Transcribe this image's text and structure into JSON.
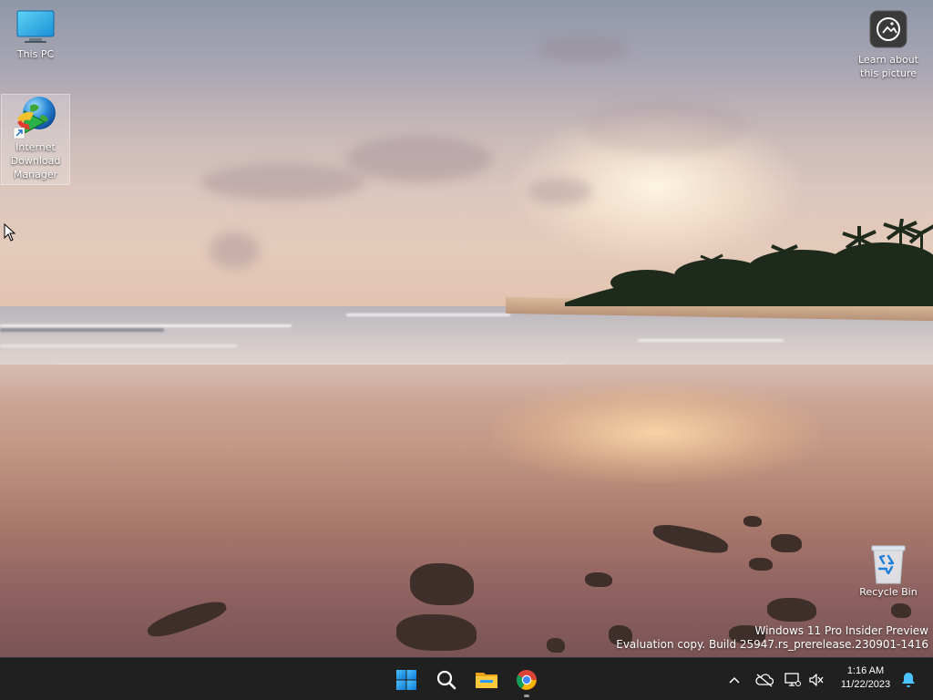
{
  "desktop": {
    "icons": {
      "this_pc": "This PC",
      "idm": "Internet Download Manager",
      "learn": "Learn about this picture",
      "recycle_bin": "Recycle Bin"
    },
    "watermark": {
      "line1": "Windows 11 Pro Insider Preview",
      "line2": "Evaluation copy. Build 25947.rs_prerelease.230901-1416"
    }
  },
  "taskbar": {
    "apps": [
      "start-icon",
      "search-icon",
      "file-explorer-icon",
      "chrome-icon"
    ],
    "tray_icons": [
      "chevron-up-icon",
      "onedrive-off-icon",
      "network-icon",
      "volume-mute-icon",
      "notification-bell-icon"
    ],
    "clock": {
      "time": "1:16 AM",
      "date": "11/22/2023"
    }
  },
  "colors": {
    "taskbar_bg": "#202020",
    "accent": "#2b9bff",
    "chrome_red": "#db4437",
    "chrome_yellow": "#f4b400",
    "chrome_green": "#0f9d58"
  }
}
